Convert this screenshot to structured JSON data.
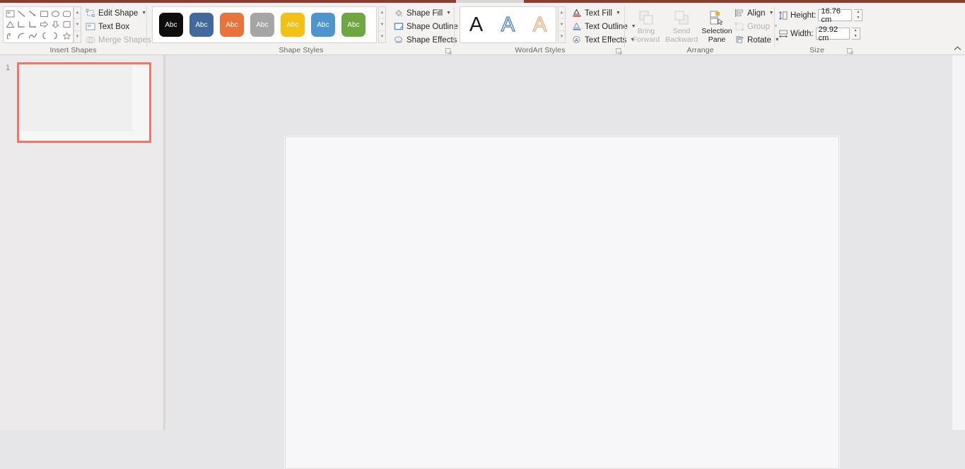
{
  "app": {
    "accent_color": "#8d3b33",
    "ribbon_bg": "#f3f2f1"
  },
  "ribbon": {
    "collapse_icon": "chevron-up-icon",
    "groups": [
      {
        "id": "insert_shapes",
        "label": "Insert Shapes"
      },
      {
        "id": "shape_styles",
        "label": "Shape Styles"
      },
      {
        "id": "wordart_styles",
        "label": "WordArt Styles"
      },
      {
        "id": "arrange",
        "label": "Arrange"
      },
      {
        "id": "size",
        "label": "Size"
      }
    ],
    "insert_shapes": {
      "shapes": [
        {
          "name": "text-box-shape-icon"
        },
        {
          "name": "line-shape-icon"
        },
        {
          "name": "line-arrow-shape-icon"
        },
        {
          "name": "rectangle-shape-icon"
        },
        {
          "name": "oval-shape-icon"
        },
        {
          "name": "rounded-rectangle-shape-icon"
        },
        {
          "name": "triangle-shape-icon"
        },
        {
          "name": "elbow-connector-shape-icon"
        },
        {
          "name": "elbow-arrow-connector-shape-icon"
        },
        {
          "name": "right-arrow-shape-icon"
        },
        {
          "name": "down-arrow-shape-icon"
        },
        {
          "name": "flowchart-shape-icon"
        },
        {
          "name": "freeform-shape-icon"
        },
        {
          "name": "arc-shape-icon"
        },
        {
          "name": "curve-shape-icon"
        },
        {
          "name": "left-brace-shape-icon"
        },
        {
          "name": "right-brace-shape-icon"
        },
        {
          "name": "star-shape-icon"
        }
      ],
      "scroll_up": "▲",
      "scroll_down": "▼",
      "scroll_more": "▼",
      "commands": [
        {
          "label": "Edit Shape",
          "icon": "edit-shape-icon",
          "dropdown": true,
          "disabled": false
        },
        {
          "label": "Text Box",
          "icon": "text-box-icon",
          "dropdown": false,
          "disabled": false
        },
        {
          "label": "Merge Shapes",
          "icon": "merge-shapes-icon",
          "dropdown": true,
          "disabled": true
        }
      ]
    },
    "shape_styles": {
      "sample_text": "Abc",
      "swatches": [
        {
          "name": "style-black",
          "fill": "#0d0d0d",
          "border": "#0d0d0d",
          "text": "#ffffff"
        },
        {
          "name": "style-blue",
          "fill": "#41699c",
          "border": "#35557d",
          "text": "#ffffff"
        },
        {
          "name": "style-orange",
          "fill": "#e8743b",
          "border": "#c35c2b",
          "text": "#ffffff"
        },
        {
          "name": "style-gray",
          "fill": "#a5a5a5",
          "border": "#8c8c8c",
          "text": "#ffffff"
        },
        {
          "name": "style-yellow",
          "fill": "#f3c014",
          "border": "#cfa20c",
          "text": "#ffffff"
        },
        {
          "name": "style-light-blue",
          "fill": "#4e95ce",
          "border": "#3c7cb0",
          "text": "#ffffff"
        },
        {
          "name": "style-green",
          "fill": "#6ea644",
          "border": "#5a8a36",
          "text": "#ffffff"
        }
      ],
      "scroll_up": "▲",
      "scroll_down": "▼",
      "scroll_more": "▼",
      "commands": [
        {
          "label": "Shape Fill",
          "icon": "shape-fill-icon",
          "dropdown": true,
          "disabled": false
        },
        {
          "label": "Shape Outline",
          "icon": "shape-outline-icon",
          "dropdown": true,
          "disabled": false
        },
        {
          "label": "Shape Effects",
          "icon": "shape-effects-icon",
          "dropdown": true,
          "disabled": false
        }
      ]
    },
    "wordart_styles": {
      "sample_letter": "A",
      "samples": [
        {
          "name": "wordart-fill-black",
          "fill": "#1a1a1a",
          "outline": "#1a1a1a"
        },
        {
          "name": "wordart-outline-blue",
          "fill": "#ffffff",
          "outline": "#4a7ebb"
        },
        {
          "name": "wordart-outline-orange",
          "fill": "#ffffff",
          "outline": "#e8a87c"
        }
      ],
      "scroll_up": "▲",
      "scroll_down": "▼",
      "scroll_more": "▼",
      "commands": [
        {
          "label": "Text Fill",
          "icon": "text-fill-icon",
          "dropdown": true,
          "disabled": false
        },
        {
          "label": "Text Outline",
          "icon": "text-outline-icon",
          "dropdown": true,
          "disabled": false
        },
        {
          "label": "Text Effects",
          "icon": "text-effects-icon",
          "dropdown": true,
          "disabled": false
        }
      ]
    },
    "arrange": {
      "buttons": [
        {
          "label_line1": "Bring",
          "label_line2": "Forward",
          "icon": "bring-forward-icon",
          "dropdown": true,
          "disabled": true
        },
        {
          "label_line1": "Send",
          "label_line2": "Backward",
          "icon": "send-backward-icon",
          "dropdown": true,
          "disabled": true
        },
        {
          "label_line1": "Selection",
          "label_line2": "Pane",
          "icon": "selection-pane-icon",
          "dropdown": false,
          "disabled": false
        }
      ],
      "commands": [
        {
          "label": "Align",
          "icon": "align-icon",
          "dropdown": true,
          "disabled": false
        },
        {
          "label": "Group",
          "icon": "group-icon",
          "dropdown": true,
          "disabled": true
        },
        {
          "label": "Rotate",
          "icon": "rotate-icon",
          "dropdown": true,
          "disabled": false
        }
      ]
    },
    "size": {
      "height": {
        "label": "Height:",
        "value": "16.76 cm",
        "icon": "shape-height-icon"
      },
      "width": {
        "label": "Width:",
        "value": "29.92 cm",
        "icon": "shape-width-icon"
      },
      "spin_up": "▲",
      "spin_down": "▼"
    }
  },
  "thumbnails": {
    "slides": [
      {
        "number": "1",
        "selected": true
      }
    ]
  },
  "slide": {
    "ghost_text": ""
  }
}
